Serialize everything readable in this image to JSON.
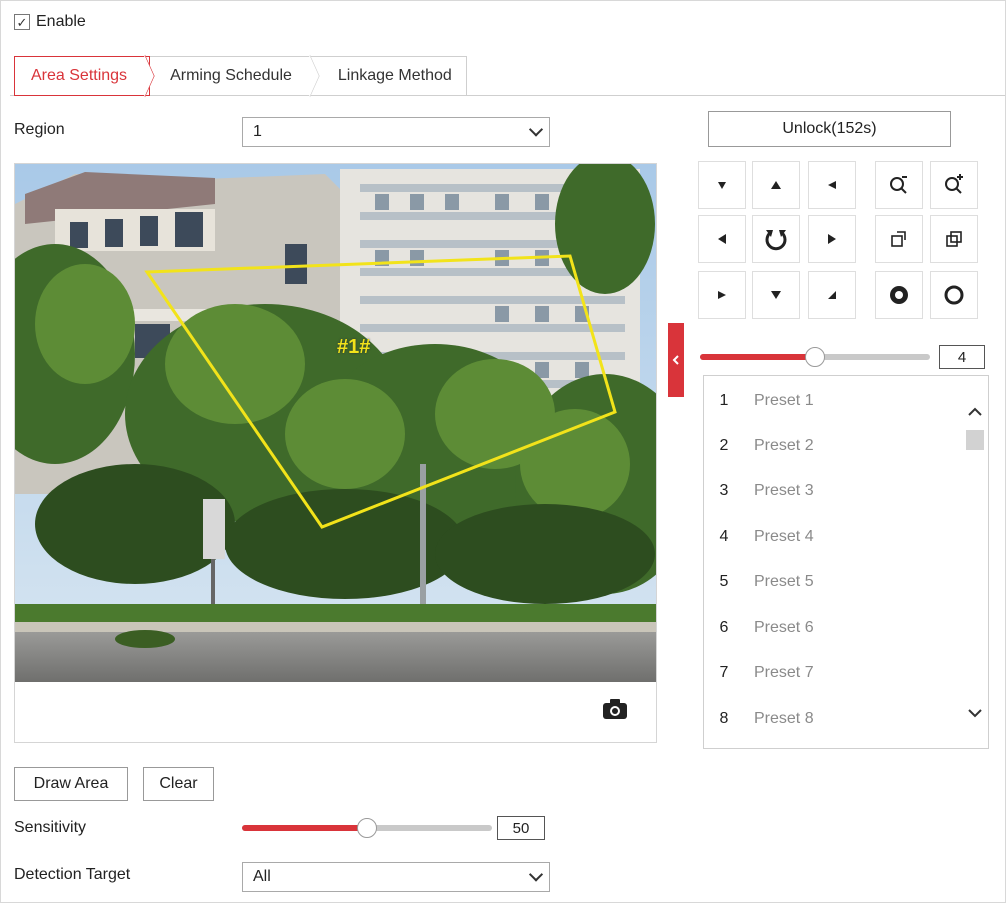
{
  "enable": {
    "label": "Enable",
    "checked": true
  },
  "tabs": [
    {
      "label": "Area Settings",
      "active": true
    },
    {
      "label": "Arming Schedule",
      "active": false
    },
    {
      "label": "Linkage Method",
      "active": false
    }
  ],
  "region": {
    "label": "Region",
    "value": "1"
  },
  "video": {
    "area_label": "#1#",
    "snapshot_icon": "camera-icon"
  },
  "buttons": {
    "draw_area": "Draw Area",
    "clear": "Clear",
    "unlock": "Unlock(152s)"
  },
  "sensitivity": {
    "label": "Sensitivity",
    "value": "50",
    "fraction": 0.5
  },
  "detection_target": {
    "label": "Detection Target",
    "value": "All"
  },
  "ptz": {
    "icons": [
      "pan-up-left-icon",
      "pan-up-icon",
      "pan-up-right-icon",
      "zoom-in-icon",
      "zoom-out-icon",
      "pan-left-icon",
      "auto-rotate-icon",
      "pan-right-icon",
      "focus-near-icon",
      "focus-far-icon",
      "pan-down-left-icon",
      "pan-down-icon",
      "pan-down-right-icon",
      "iris-open-icon",
      "iris-close-icon"
    ],
    "speed": {
      "value": "4",
      "fraction": 0.5
    }
  },
  "presets": [
    {
      "num": "1",
      "name": "Preset 1"
    },
    {
      "num": "2",
      "name": "Preset 2"
    },
    {
      "num": "3",
      "name": "Preset 3"
    },
    {
      "num": "4",
      "name": "Preset 4"
    },
    {
      "num": "5",
      "name": "Preset 5"
    },
    {
      "num": "6",
      "name": "Preset 6"
    },
    {
      "num": "7",
      "name": "Preset 7"
    },
    {
      "num": "8",
      "name": "Preset 8"
    }
  ],
  "colors": {
    "accent": "#d9343a",
    "area_outline": "#f2e31a"
  }
}
